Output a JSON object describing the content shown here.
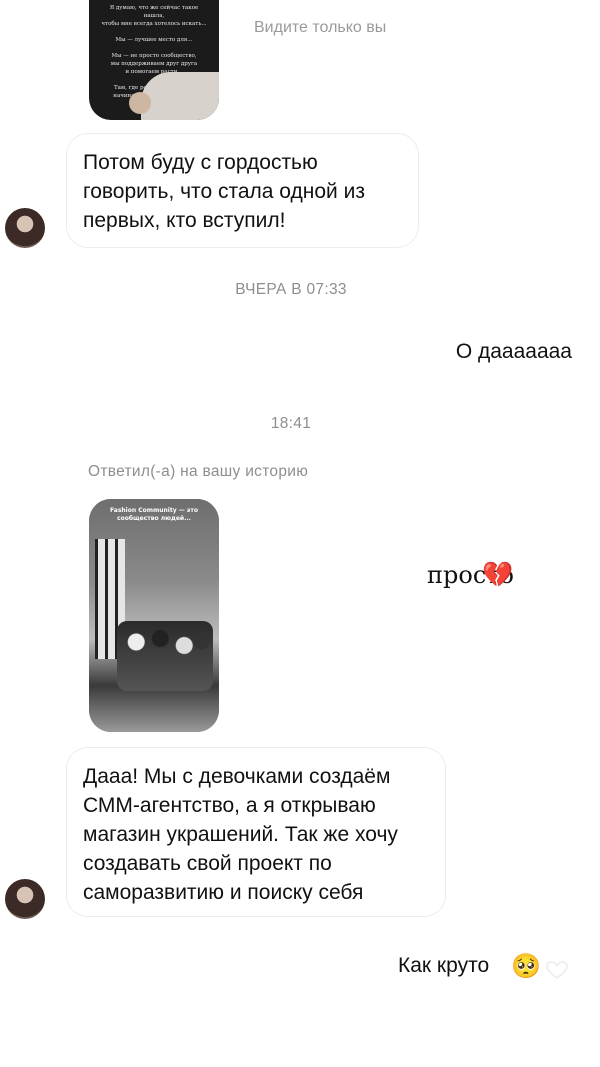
{
  "thread": {
    "first_story": {
      "visibility_note": "Видите только вы"
    },
    "incoming_message_1": "Потом буду с гордостью говорить, что стала одной из первых, кто вступил!",
    "timestamp_1": "ВЧЕРА В 07:33",
    "outgoing_message_1": "О дааааааа",
    "timestamp_2": "18:41",
    "story_reply_label": "Ответил(-а) на вашу историю",
    "second_story": {
      "title": "Fashion Community — это сообщество людей..."
    },
    "outgoing_message_2": "просто",
    "outgoing_message_2_emoji": "💔",
    "incoming_message_2": "Дааа! Мы с девочками создаём СММ-агентство, а я открываю магазин украшений. Так же хочу создавать свой проект по саморазвитию и поиску себя",
    "outgoing_message_3": "Как круто",
    "outgoing_message_3_emoji": "🥺",
    "like_icon": "heart-outline-icon"
  }
}
